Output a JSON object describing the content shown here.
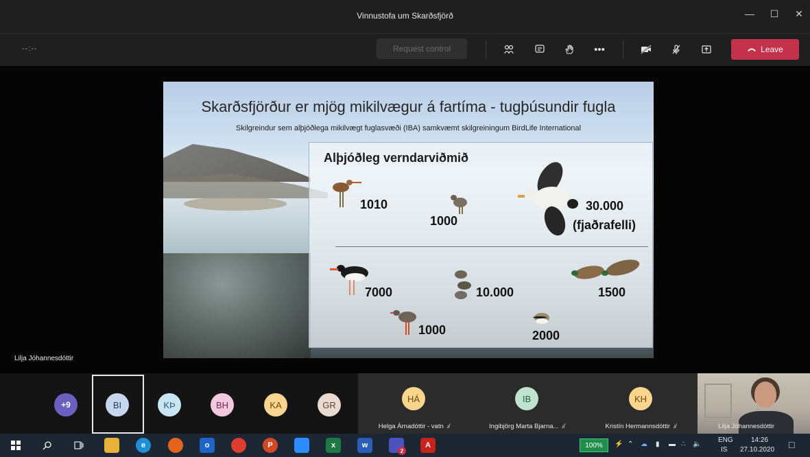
{
  "window": {
    "title": "Vinnustofa um Skarðsfjörð",
    "minimize_icon": "minimize-icon",
    "maximize_icon": "maximize-icon",
    "close_icon": "close-icon"
  },
  "toolbar": {
    "timer": "--:--",
    "request_control_label": "Request control",
    "leave_label": "Leave",
    "leave_color": "#c4314b"
  },
  "slide": {
    "title": "Skarðsfjörður er mjög mikilvægur á fartíma - tugþúsundir fugla",
    "subtitle": "Skilgreindur sem alþjóðlega mikilvægt fuglasvæði (IBA) samkvæmt skilgreiningum BirdLife International",
    "panel_title": "Alþjóðleg verndarviðmið",
    "counts": {
      "godwit": "1010",
      "knot": "1000",
      "eider_count": "30.000",
      "eider_note": "(fjaðrafelli)",
      "oystercatcher": "7000",
      "dunlin": "10.000",
      "teal": "1500",
      "redshank": "1000",
      "plover": "2000"
    }
  },
  "speaker_name": "Lilja Jóhannesdóttir",
  "participants": {
    "more": "+9",
    "avatars": [
      {
        "initials": "BI",
        "bg": "#c6d6ee",
        "fg": "#23415f"
      },
      {
        "initials": "KÞ",
        "bg": "#c9e4f2",
        "fg": "#1f5a78"
      },
      {
        "initials": "BH",
        "bg": "#f2c9dc",
        "fg": "#7a2450"
      },
      {
        "initials": "KA",
        "bg": "#fbd58f",
        "fg": "#6b4a06"
      },
      {
        "initials": "GR",
        "bg": "#ead9cf",
        "fg": "#5e4436"
      }
    ],
    "tiles": [
      {
        "initials": "HÁ",
        "bg": "#f9d58d",
        "fg": "#6b4a06",
        "name": "Helga Árnadóttir - vatn"
      },
      {
        "initials": "IB",
        "bg": "#bfe3cf",
        "fg": "#245c3f",
        "name": "Ingibjörg Marta Bjarna..."
      },
      {
        "initials": "KH",
        "bg": "#f9d58d",
        "fg": "#6b4a06",
        "name": "Kristín Hermannsdóttir"
      }
    ],
    "video_name": "Lilja Jóhannesdóttir"
  },
  "taskbar": {
    "battery": "100%",
    "lang_top": "ENG",
    "lang_bottom": "IS",
    "time": "14:26",
    "date": "27.10.2020",
    "teams_badge": "2"
  }
}
